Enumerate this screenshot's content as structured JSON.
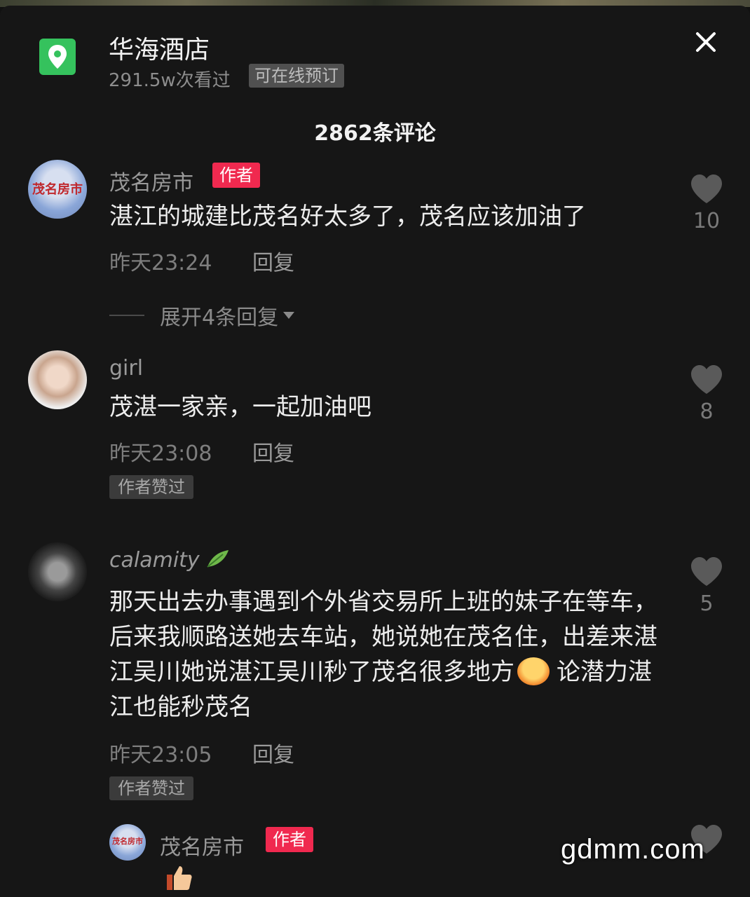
{
  "header": {
    "place_title": "华海酒店",
    "views": "291.5w次看过",
    "booking_badge": "可在线预订"
  },
  "comments_header": {
    "count_label": "2862条评论"
  },
  "comments": [
    {
      "avatar_label": "茂名房市",
      "username": "茂名房市",
      "author_badge": "作者",
      "text": "湛江的城建比茂名好太多了，茂名应该加油了",
      "time": "昨天23:24",
      "reply_label": "回复",
      "likes": "10",
      "expand_label": "展开4条回复"
    },
    {
      "username": "girl",
      "text": "茂湛一家亲，一起加油吧",
      "time": "昨天23:08",
      "reply_label": "回复",
      "liked_by_author": "作者赞过",
      "likes": "8"
    },
    {
      "username": "calamity",
      "text_part1": "那天出去办事遇到个外省交易所上班的妹子在等车，后来我顺路送她去车站，她说她在茂名住，出差来湛江吴川她说湛江吴川秒了茂名很多地方",
      "text_part2": "论潜力湛江也能秒茂名",
      "time": "昨天23:05",
      "reply_label": "回复",
      "liked_by_author": "作者赞过",
      "likes": "5"
    },
    {
      "avatar_label": "茂名房市",
      "username": "茂名房市",
      "author_badge": "作者"
    }
  ],
  "watermark": "gdmm.com",
  "colors": {
    "background": "#161616",
    "author_badge": "#f0294f",
    "location_icon": "#35c25d"
  },
  "icons": [
    "location-pin-icon",
    "close-icon",
    "heart-icon",
    "caret-down-icon",
    "thumbs-up-icon",
    "leaf-icon"
  ]
}
